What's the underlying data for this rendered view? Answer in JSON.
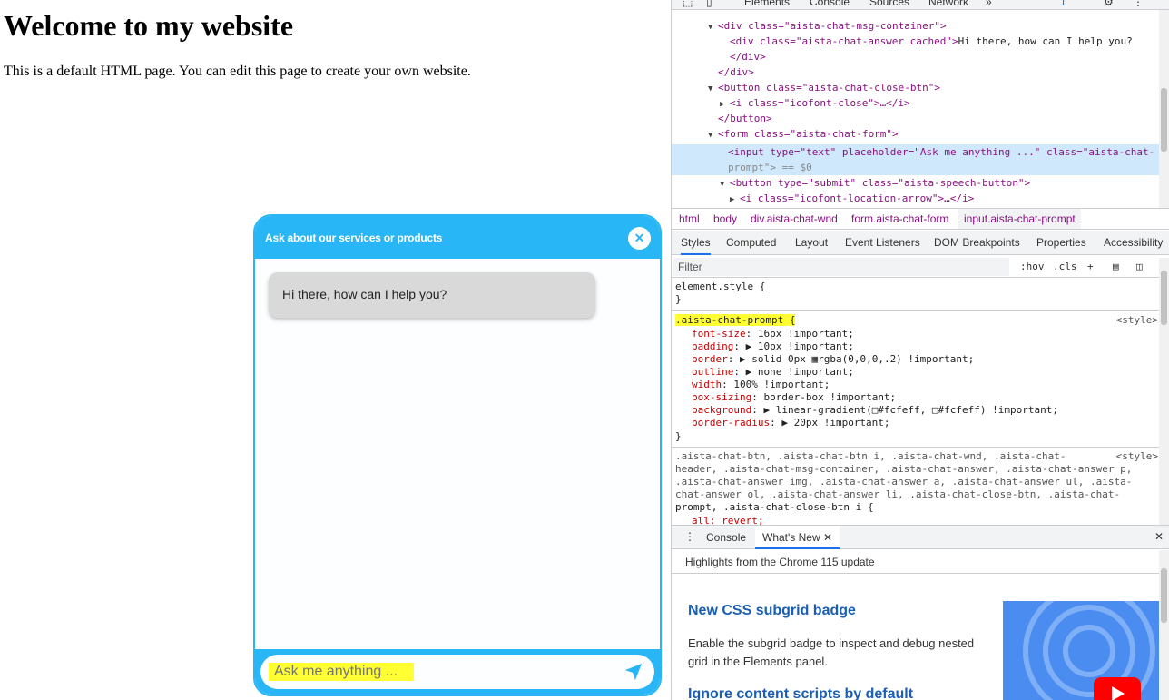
{
  "page": {
    "heading": "Welcome to my website",
    "paragraph": "This is a default HTML page. You can edit this page to create your own website."
  },
  "chat": {
    "title": "Ask about our services or products",
    "close_icon": "close-icon",
    "answer": "Hi there, how can I help you?",
    "prompt_placeholder": "Ask me anything ...",
    "send_icon": "location-arrow-icon",
    "accent_color": "#29b6f6",
    "highlight_color": "#ffff33"
  },
  "devtools": {
    "top_tabs": [
      "Elements",
      "Console",
      "Sources",
      "Network"
    ],
    "badge": "1",
    "dom": {
      "line1": "<div class=\"aista-chat-msg-container\">",
      "line2_open": "<div class=\"aista-chat-answer cached\">",
      "line2_text": "Hi there, how can I help you?",
      "line3": "</div>",
      "line4": "</div>",
      "line5": "<button class=\"aista-chat-close-btn\">",
      "line6": "<i class=\"icofont-close\">…</i>",
      "line7": "</button>",
      "line8": "<form class=\"aista-chat-form\">",
      "line9a": "<input type=\"text\" placeholder=\"Ask me anything ...\" class=\"aista-chat-",
      "line9b": "prompt\"> == $0",
      "line10": "<button type=\"submit\" class=\"aista-speech-button\">",
      "line11": "<i class=\"icofont-location-arrow\">…</i>"
    },
    "breadcrumbs": [
      "html",
      "body",
      "div.aista-chat-wnd",
      "form.aista-chat-form",
      "input.aista-chat-prompt"
    ],
    "style_tabs": [
      "Styles",
      "Computed",
      "Layout",
      "Event Listeners",
      "DOM Breakpoints",
      "Properties",
      "Accessibility"
    ],
    "filter_placeholder": "Filter",
    "filter_hov": ":hov",
    "filter_cls": ".cls",
    "styles": {
      "element_style": "element.style {",
      "close_brace": "}",
      "rule1_selector": ".aista-chat-prompt {",
      "rule1_source": "<style>",
      "rule1_props": [
        {
          "name": "font-size",
          "value": "16px !important;"
        },
        {
          "name": "padding",
          "value": "▶ 10px !important;"
        },
        {
          "name": "border",
          "value": "▶ solid 0px ▦rgba(0,0,0,.2) !important;"
        },
        {
          "name": "outline",
          "value": "▶ none !important;"
        },
        {
          "name": "width",
          "value": "100% !important;"
        },
        {
          "name": "box-sizing",
          "value": "border-box !important;"
        },
        {
          "name": "background",
          "value": "▶ linear-gradient(□#fcfeff, □#fcfeff) !important;"
        },
        {
          "name": "border-radius",
          "value": "▶ 20px !important;"
        }
      ],
      "rule2_lines": [
        ".aista-chat-btn, .aista-chat-btn i, .aista-chat-wnd, .aista-chat-",
        "header, .aista-chat-msg-container, .aista-chat-answer, .aista-chat-answer p,",
        ".aista-chat-answer img, .aista-chat-answer a, .aista-chat-answer ul, .aista-",
        "chat-answer ol, .aista-chat-answer li, .aista-chat-close-btn, .aista-chat-",
        "prompt, .aista-chat-close-btn i {"
      ],
      "rule2_source": "<style>",
      "rule2_prop": "all: revert;"
    },
    "drawer": {
      "tabs": [
        "Console",
        "What's New"
      ],
      "header": "Highlights from the Chrome 115 update",
      "item1_title": "New CSS subgrid badge",
      "item1_text": "Enable the subgrid badge to inspect and debug nested grid in the Elements panel.",
      "item2_title": "Ignore content scripts by default"
    }
  }
}
